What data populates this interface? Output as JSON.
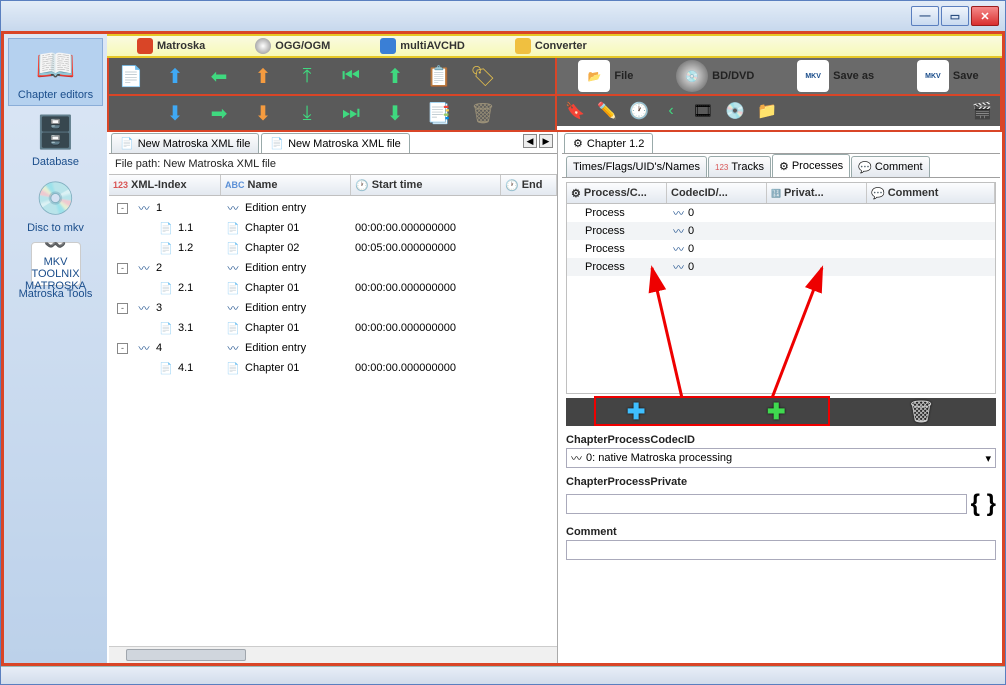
{
  "sidebar": {
    "items": [
      {
        "label": "Chapter editors"
      },
      {
        "label": "Database"
      },
      {
        "label": "Disc to mkv"
      },
      {
        "label": "Matroska Tools"
      }
    ]
  },
  "menubar": {
    "items": [
      {
        "label": "Matroska"
      },
      {
        "label": "OGG/OGM"
      },
      {
        "label": "multiAVCHD"
      },
      {
        "label": "Converter"
      }
    ]
  },
  "filebar": {
    "file": "File",
    "bddvd": "BD/DVD",
    "saveas": "Save as",
    "save": "Save"
  },
  "tabs": {
    "t1": "New Matroska XML file",
    "t2": "New Matroska XML file"
  },
  "filepath": "File path: New Matroska XML file",
  "grid": {
    "col_index": "XML-Index",
    "col_name": "Name",
    "col_start": "Start time",
    "col_end": "End"
  },
  "tree": [
    {
      "depth": 0,
      "exp": "-",
      "idx": "1",
      "name": "Edition entry",
      "start": "",
      "type": "ed"
    },
    {
      "depth": 1,
      "exp": "",
      "idx": "1.1",
      "name": "Chapter 01",
      "start": "00:00:00.000000000",
      "type": "ch"
    },
    {
      "depth": 1,
      "exp": "",
      "idx": "1.2",
      "name": "Chapter 02",
      "start": "00:05:00.000000000",
      "type": "ch"
    },
    {
      "depth": 0,
      "exp": "-",
      "idx": "2",
      "name": "Edition entry",
      "start": "",
      "type": "ed"
    },
    {
      "depth": 1,
      "exp": "",
      "idx": "2.1",
      "name": "Chapter 01",
      "start": "00:00:00.000000000",
      "type": "ch"
    },
    {
      "depth": 0,
      "exp": "-",
      "idx": "3",
      "name": "Edition entry",
      "start": "",
      "type": "ed"
    },
    {
      "depth": 1,
      "exp": "",
      "idx": "3.1",
      "name": "Chapter 01",
      "start": "00:00:00.000000000",
      "type": "ch"
    },
    {
      "depth": 0,
      "exp": "-",
      "idx": "4",
      "name": "Edition entry",
      "start": "",
      "type": "ed"
    },
    {
      "depth": 1,
      "exp": "",
      "idx": "4.1",
      "name": "Chapter 01",
      "start": "00:00:00.000000000",
      "type": "ch"
    }
  ],
  "chapter_tab": "Chapter 1.2",
  "subtabs": {
    "times": "Times/Flags/UID's/Names",
    "tracks": "Tracks",
    "processes": "Processes",
    "comment": "Comment"
  },
  "proc_head": {
    "c1": "Process/C...",
    "c2": "CodecID/...",
    "c3": "Privat...",
    "c4": "Comment"
  },
  "proc_rows": [
    {
      "name": "Process",
      "codec": "0"
    },
    {
      "name": "Process",
      "codec": "0"
    },
    {
      "name": "Process",
      "codec": "0"
    },
    {
      "name": "Process",
      "codec": "0"
    }
  ],
  "form": {
    "codecid_label": "ChapterProcessCodecID",
    "codecid_value": "0: native Matroska processing",
    "private_label": "ChapterProcessPrivate",
    "comment_label": "Comment"
  },
  "mkv_logo_line1": "MKV TOOLNIX",
  "mkv_logo_line2": "MATROSKA"
}
